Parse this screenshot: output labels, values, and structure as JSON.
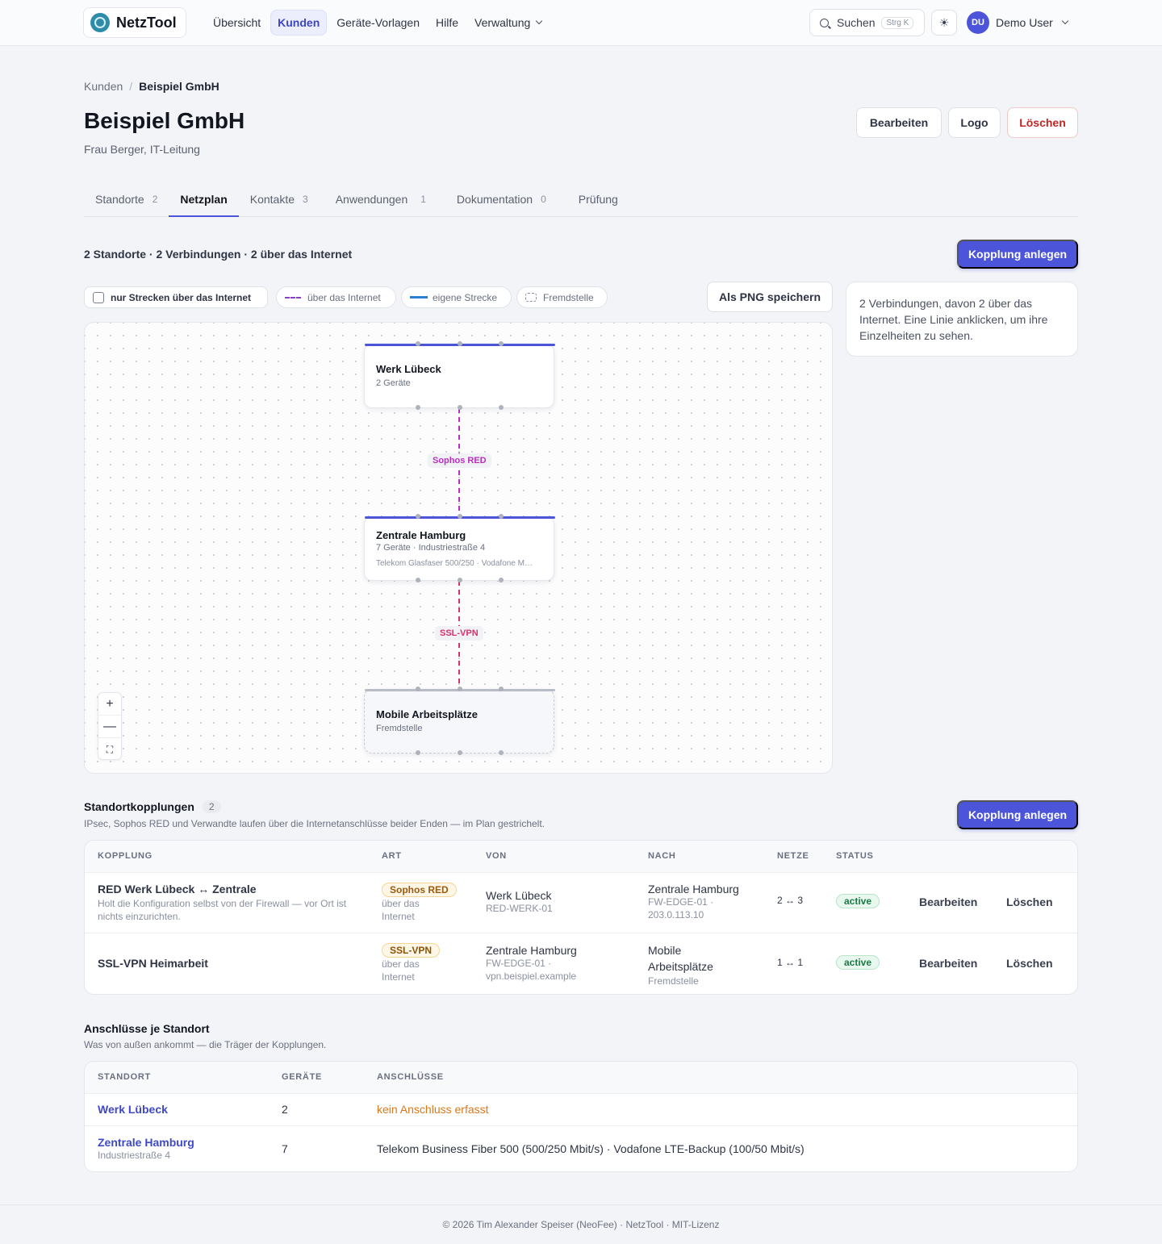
{
  "nav": {
    "brand": "NetzTool",
    "links": [
      "Übersicht",
      "Kunden",
      "Geräte-Vorlagen",
      "Hilfe",
      "Verwaltung"
    ],
    "search_label": "Suchen",
    "search_kbd": "Strg K",
    "user_initials": "DU",
    "user_name": "Demo User"
  },
  "breadcrumb": {
    "parent": "Kunden",
    "current": "Beispiel GmbH"
  },
  "customer": {
    "name": "Beispiel GmbH",
    "contact": "Frau Berger, IT-Leitung"
  },
  "header_buttons": {
    "edit": "Bearbeiten",
    "logo": "Logo",
    "delete": "Löschen"
  },
  "tabs": [
    {
      "label": "Standorte",
      "count": "2"
    },
    {
      "label": "Netzplan",
      "count": ""
    },
    {
      "label": "Kontakte",
      "count": "3"
    },
    {
      "label": "Anwendungen",
      "count": "1"
    },
    {
      "label": "Dokumentation",
      "count": "0"
    },
    {
      "label": "Prüfung",
      "count": ""
    }
  ],
  "netzplan": {
    "summary": "2 Standorte · 2 Verbindungen · 2 über das Internet",
    "create_button": "Kopplung anlegen",
    "filter_internet_only": "nur Strecken über das Internet",
    "legend_internet": "über das Internet",
    "legend_own": "eigene Strecke",
    "legend_external": "Fremdstelle",
    "save_png": "Als PNG speichern",
    "info": "2 Verbindungen, davon 2 über das Internet. Eine Linie anklicken, um ihre Einzelheiten zu sehen.",
    "nodes": [
      {
        "title": "Werk Lübeck",
        "sub": "2 Geräte",
        "line": ""
      },
      {
        "title": "Zentrale Hamburg",
        "sub": "7 Geräte · Industriestraße 4",
        "line": "Telekom Glasfaser 500/250 · Vodafone M…"
      },
      {
        "title": "Mobile Arbeitsplätze",
        "sub": "Fremdstelle",
        "line": ""
      }
    ],
    "edges": [
      {
        "label": "Sophos RED",
        "color": "#b92fc2"
      },
      {
        "label": "SSL-VPN",
        "color": "#d6326f"
      }
    ]
  },
  "couplings": {
    "title": "Standortkopplungen",
    "count": "2",
    "subtitle": "IPsec, Sophos RED und Verwandte laufen über die Internetanschlüsse beider Enden — im Plan gestrichelt.",
    "create_button": "Kopplung anlegen",
    "columns": [
      "KOPPLUNG",
      "ART",
      "VON",
      "NACH",
      "NETZE",
      "STATUS"
    ],
    "rows": [
      {
        "name": "RED Werk Lübeck ↔ Zentrale",
        "desc": "Holt die Konfiguration selbst von der Firewall — vor Ort ist nichts einzurichten.",
        "type": "Sophos RED",
        "type_sub": "über das Internet",
        "from": "Werk Lübeck",
        "from_sub": "RED-WERK-01",
        "to": "Zentrale Hamburg",
        "to_sub": "FW-EDGE-01 · 203.0.113.10",
        "nets": "2 ↔ 3",
        "status": "active",
        "edit": "Bearbeiten",
        "delete": "Löschen"
      },
      {
        "name": "SSL-VPN Heimarbeit",
        "desc": "",
        "type": "SSL-VPN",
        "type_sub": "über das Internet",
        "from": "Zentrale Hamburg",
        "from_sub": "FW-EDGE-01 · vpn.beispiel.example",
        "to": "Mobile Arbeitsplätze",
        "to_sub": "Fremdstelle",
        "nets": "1 ↔ 1",
        "status": "active",
        "edit": "Bearbeiten",
        "delete": "Löschen"
      }
    ]
  },
  "connections": {
    "title": "Anschlüsse je Standort",
    "subtitle": "Was von außen ankommt — die Träger der Kopplungen.",
    "columns": [
      "STANDORT",
      "GERÄTE",
      "ANSCHLÜSSE"
    ],
    "rows": [
      {
        "site": "Werk Lübeck",
        "site_sub": "",
        "devices": "2",
        "links": "kein Anschluss erfasst"
      },
      {
        "site": "Zentrale Hamburg",
        "site_sub": "Industriestraße 4",
        "devices": "7",
        "links": "Telekom Business Fiber 500 (500/250 Mbit/s) · Vodafone LTE-Backup (100/50 Mbit/s)"
      }
    ]
  },
  "footer": "© 2026 Tim Alexander Speiser (NeoFee) · NetzTool · MIT-Lizenz"
}
